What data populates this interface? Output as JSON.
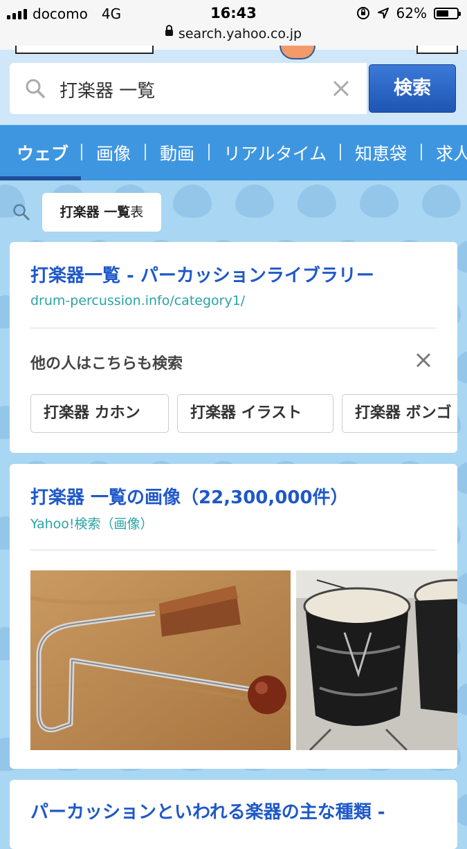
{
  "status_bar": {
    "carrier": "docomo",
    "network": "4G",
    "time": "16:43",
    "battery": "62%",
    "battery_level": 0.62
  },
  "url_bar": {
    "url": "search.yahoo.co.jp"
  },
  "search": {
    "query": "打楽器 一覧",
    "button_label": "検索"
  },
  "tabs": [
    {
      "label": "ウェブ",
      "active": true
    },
    {
      "label": "画像"
    },
    {
      "label": "動画"
    },
    {
      "label": "リアルタイム"
    },
    {
      "label": "知恵袋"
    },
    {
      "label": "求人"
    }
  ],
  "related_chip": {
    "bold": "打楽器 一覧",
    "rest": "表"
  },
  "results": [
    {
      "title": "打楽器一覧 - パーカッションライブラリー",
      "url": "drum-percussion.info/category1/"
    },
    {
      "title": "打楽器 一覧の画像（22,300,000件）",
      "url": "Yahoo!検索（画像）"
    },
    {
      "title": "パーカッションといわれる楽器の主な種類 -"
    }
  ],
  "also_searched": {
    "title": "他の人はこちらも検索",
    "chips": [
      "打楽器 カホン",
      "打楽器 イラスト",
      "打楽器 ボンゴ"
    ]
  },
  "colors": {
    "accent": "#3f96e0",
    "link": "#1e58c9",
    "url": "#2aa3a3",
    "background": "#a9d6f2"
  },
  "icons": [
    "signal-icon",
    "lock-icon",
    "location-arrow-icon",
    "orientation-lock-icon",
    "battery-icon",
    "search-icon",
    "clear-icon",
    "close-icon"
  ]
}
